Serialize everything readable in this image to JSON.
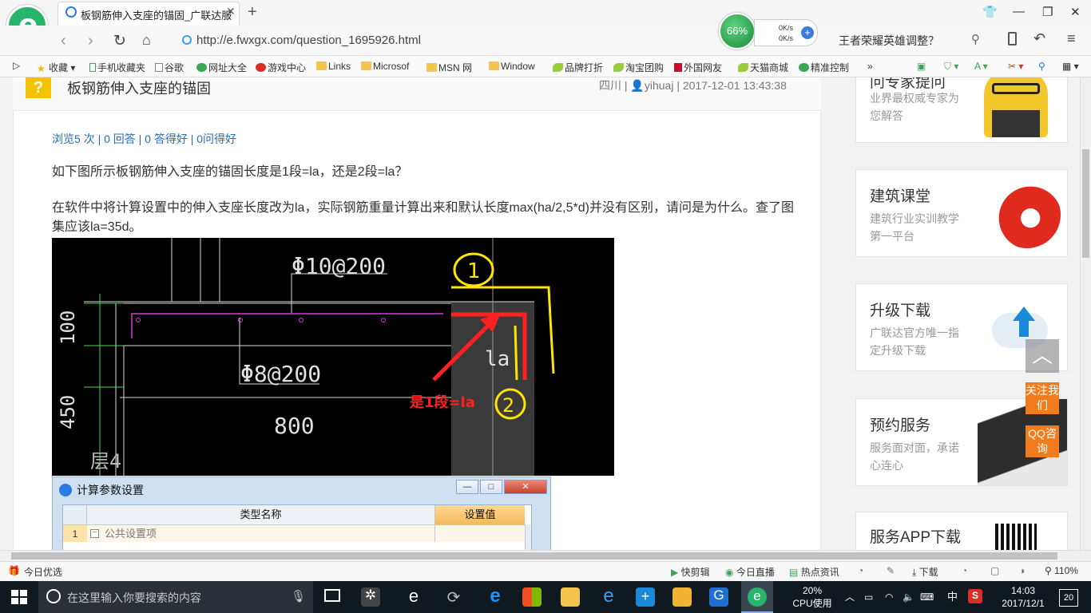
{
  "browser": {
    "tab_title": "板钢筋伸入支座的锚固_广联达服",
    "url": "http://e.fwxgx.com/question_1695926.html",
    "speed_percent": "66%",
    "speed_up": "0K/s",
    "speed_down": "0K/s",
    "search_text": "王者荣耀英雄调整？",
    "bookmarks": [
      "收藏",
      "手机收藏夹",
      "谷歌",
      "网址大全",
      "游戏中心",
      "Links",
      "Microsof",
      "MSN 网",
      "Window",
      "品牌打折",
      "淘宝团购",
      "外国网友",
      "天猫商城",
      "精准控制"
    ]
  },
  "question": {
    "title": "板钢筋伸入支座的锚固",
    "location": "四川",
    "user": "yihuaj",
    "datetime": "2017-12-01 13:43:38",
    "stats": "浏览5 次 | 0 回答 | 0 答得好 | 0问得好",
    "para1": "如下图所示板钢筋伸入支座的锚固长度是1段=la，还是2段=la？",
    "para2": "在软件中将计算设置中的伸入支座长度改为la，实际钢筋重量计算出来和默认长度max(ha/2,5*d)并没有区别，请问是为什么。查了图集应该la=35d。"
  },
  "cad": {
    "label_top_rebar": "Φ10@200",
    "label_bottom_rebar": "Φ8@200",
    "dim_100": "100",
    "dim_450": "450",
    "dim_800": "800",
    "label_la": "la",
    "annotation": "是1段=la",
    "circle1": "1",
    "circle2": "2",
    "label_floor": "层4"
  },
  "dialog": {
    "title": "计算参数设置",
    "col_name": "类型名称",
    "col_value": "设置值",
    "row_num": "1",
    "row_label": "公共设置项",
    "min": "—",
    "max": "□",
    "close": "✕"
  },
  "sidebar": {
    "card0_title": "问专家提问",
    "card0_sub": "业界最权威专家为您解答",
    "card1_title": "建筑课堂",
    "card1_sub": "建筑行业实训教学第一平台",
    "card2_title": "升级下载",
    "card2_sub": "广联达官方唯一指定升级下载",
    "card3_title": "预约服务",
    "card3_sub": "服务面对面，承诺心连心",
    "card4_title": "服务APP下载",
    "follow": "关注我们",
    "qq": "QQ咨询"
  },
  "statusbar": {
    "left": "今日优选",
    "items": [
      "快剪辑",
      "今日直播",
      "热点资讯",
      "下载"
    ],
    "zoom": "110%"
  },
  "taskbar": {
    "search_placeholder": "在这里输入你要搜索的内容",
    "cpu_percent": "20%",
    "cpu_label": "CPU使用",
    "ime": "中",
    "time": "14:03",
    "date": "2017/12/1",
    "notif_count": "20"
  },
  "colors": {
    "accent_green": "#28b46b",
    "link_blue": "#2a6db5",
    "orange": "#f07c1d",
    "cad_red": "#ff2020",
    "cad_yellow": "#ffe600",
    "cad_magenta": "#d23cd2"
  }
}
